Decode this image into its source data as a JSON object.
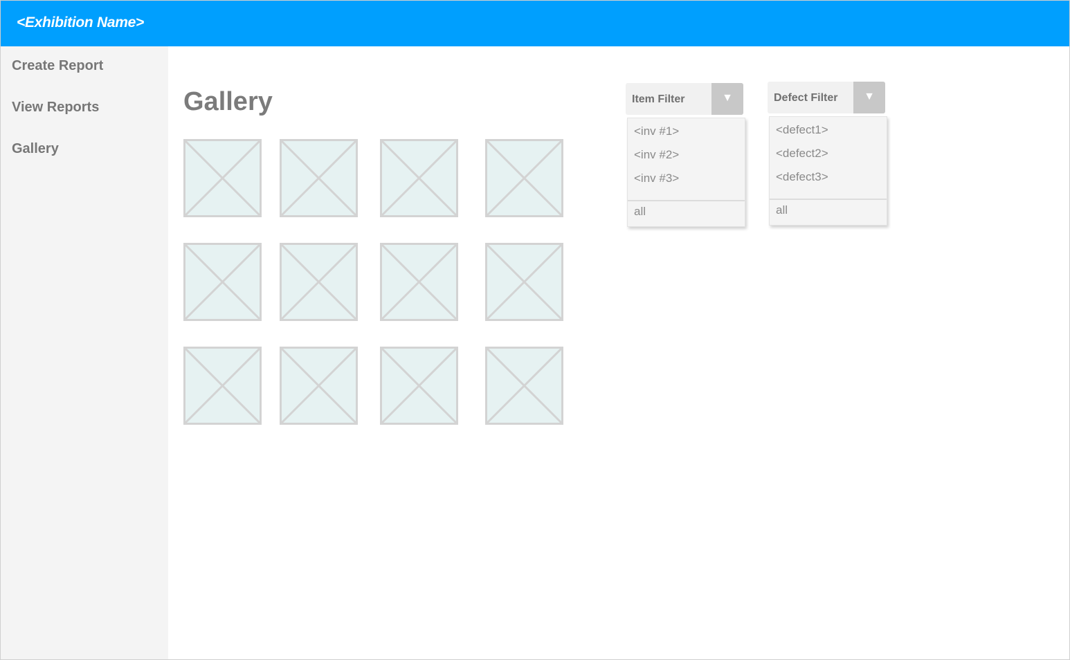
{
  "header": {
    "title": "<Exhibition Name>"
  },
  "sidebar": {
    "items": [
      {
        "label": "Create Report"
      },
      {
        "label": "View Reports"
      },
      {
        "label": "Gallery"
      }
    ]
  },
  "main": {
    "title": "Gallery"
  },
  "gallery": {
    "images": [
      "image-placeholder-icon",
      "image-placeholder-icon",
      "image-placeholder-icon",
      "image-placeholder-icon",
      "image-placeholder-icon",
      "image-placeholder-icon",
      "image-placeholder-icon",
      "image-placeholder-icon",
      "image-placeholder-icon",
      "image-placeholder-icon",
      "image-placeholder-icon",
      "image-placeholder-icon"
    ]
  },
  "filters": {
    "item": {
      "label": "Item Filter",
      "caret_icon": "triangle-down-icon",
      "options": [
        "<inv #1>",
        "<inv #2>",
        "<inv #3>"
      ],
      "all_label": "all"
    },
    "defect": {
      "label": "Defect Filter",
      "caret_icon": "triangle-down-icon",
      "options": [
        "<defect1>",
        "<defect2>",
        "<defect3>"
      ],
      "all_label": "all"
    }
  },
  "colors": {
    "header_bg": "#009ffe",
    "sidebar_bg": "#f4f4f4",
    "placeholder_fill": "#e6f2f2",
    "placeholder_stroke": "#d3d3d3"
  }
}
